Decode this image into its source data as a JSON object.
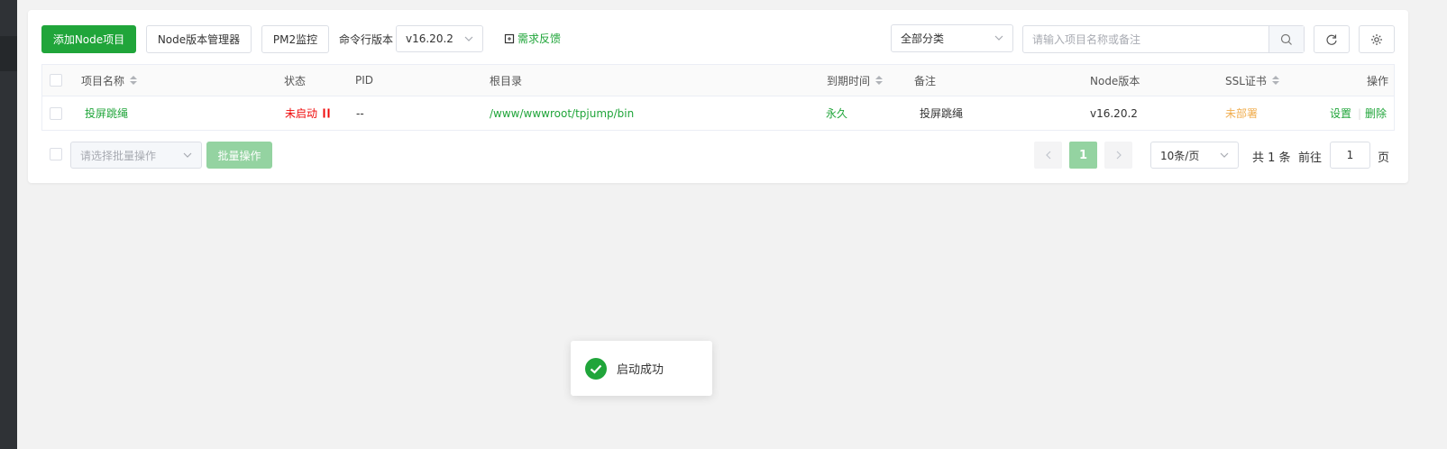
{
  "toolbar": {
    "add_project": "添加Node项目",
    "node_version_manager": "Node版本管理器",
    "pm2_monitor": "PM2监控",
    "cli_version_label": "命令行版本",
    "cli_version_value": "v16.20.2",
    "feedback": "需求反馈",
    "category_select": "全部分类",
    "search_placeholder": "请输入项目名称或备注"
  },
  "table": {
    "columns": {
      "name": "项目名称",
      "status": "状态",
      "pid": "PID",
      "root": "根目录",
      "expire": "到期时间",
      "remark": "备注",
      "node_version": "Node版本",
      "ssl": "SSL证书",
      "actions": "操作"
    },
    "rows": [
      {
        "name": "投屏跳绳",
        "status": "未启动",
        "status_icon": "pause-icon",
        "pid": "--",
        "root": "/www/wwwroot/tpjump/bin",
        "expire": "永久",
        "remark": "投屏跳绳",
        "node_version": "v16.20.2",
        "ssl": "未部署",
        "action_settings": "设置",
        "action_sep": "|",
        "action_delete": "删除"
      }
    ]
  },
  "footer": {
    "batch_placeholder": "请选择批量操作",
    "batch_button": "批量操作",
    "current_page": "1",
    "page_size": "10条/页",
    "total_text": "共 1 条",
    "goto_label": "前往",
    "goto_value": "1",
    "page_suffix": "页"
  },
  "toast": {
    "message": "启动成功",
    "icon": "check-circle-icon"
  },
  "colors": {
    "accent": "#20a53a",
    "danger": "#ef0808",
    "warning": "#f0ad4e"
  }
}
